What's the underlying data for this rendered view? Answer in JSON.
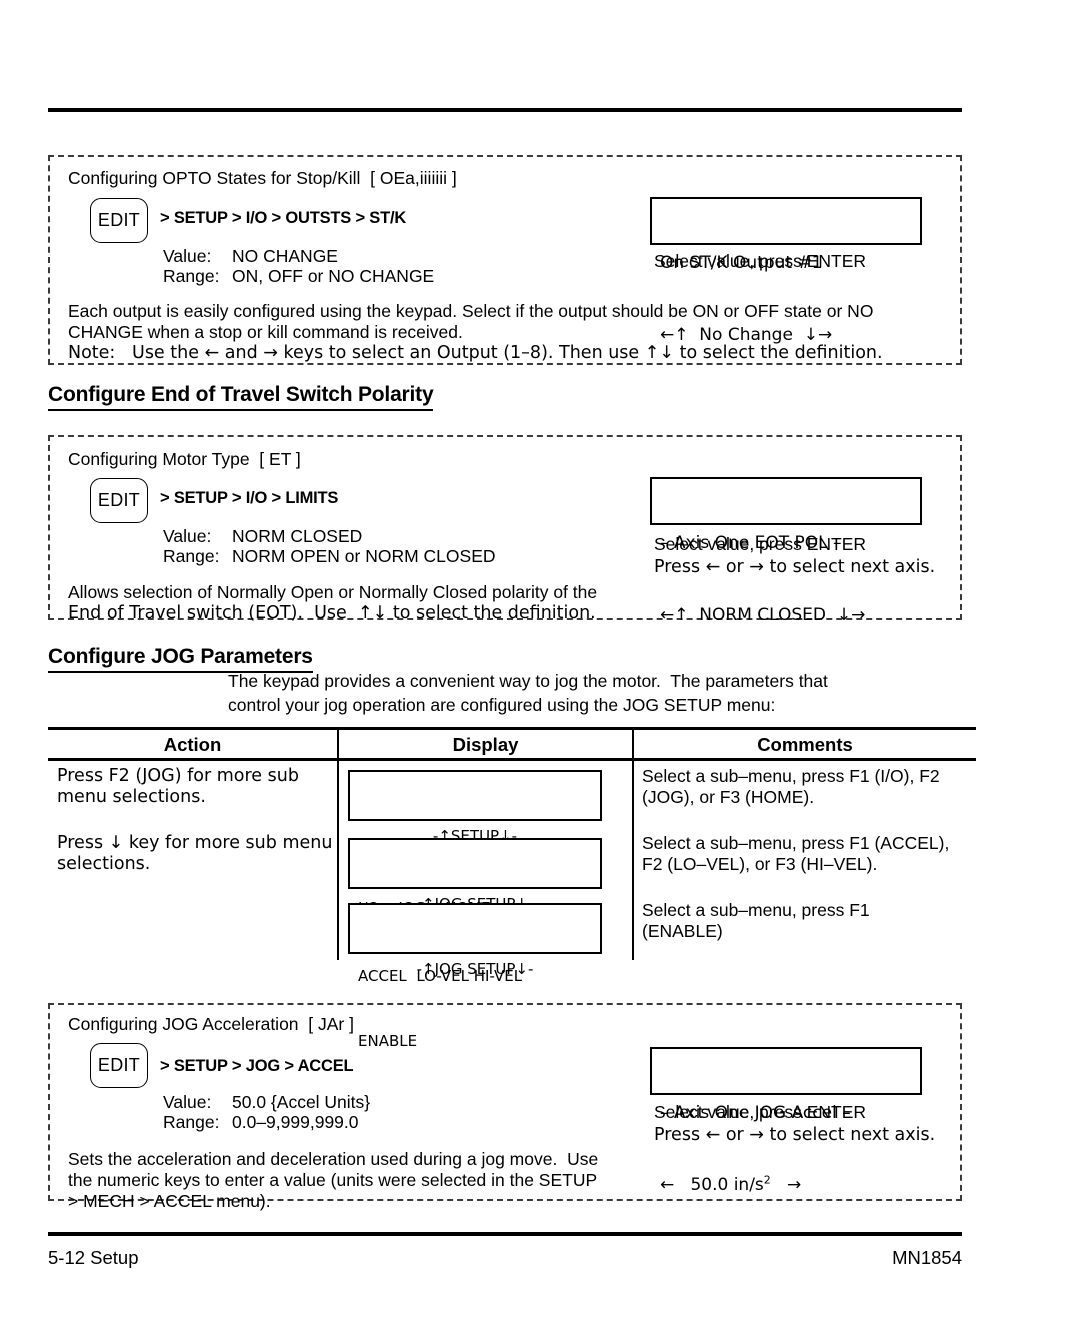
{
  "page": {
    "footer_left": "5-12 Setup",
    "footer_right": "MN1854"
  },
  "sections": [
    {
      "id": "opto-states",
      "param_title": "Configuring OPTO States for Stop/Kill  [ OEa,iiiiiii ]",
      "edit_label": "EDIT",
      "menu_path": "> SETUP > I/O > OUTSTS > ST/K",
      "value_label": "Value:",
      "value": "NO CHANGE",
      "range_label": "Range:",
      "range": "ON, OFF or NO CHANGE",
      "lcd_line1": "On ST/K Output #1",
      "lcd_line2": "←↑  No Change  ↓→",
      "lcd_caption1": "Select value, press ENTER",
      "body": "Each output is easily configured using the keypad. Select if the output should be ON or OFF state or NO CHANGE when a stop or kill command is received.",
      "note": "Note:   Use the ← and → keys to select an Output (1–8). Then use ↑↓ to select the definition."
    },
    {
      "id": "eot-polarity",
      "heading": "Configure End of Travel Switch Polarity",
      "param_title": "Configuring Motor Type  [ ET ]",
      "edit_label": "EDIT",
      "menu_path": "> SETUP > I/O > LIMITS",
      "value_label": "Value:",
      "value": "NORM CLOSED",
      "range_label": "Range:",
      "range": "NORM OPEN or NORM CLOSED",
      "lcd_line1": "– Axis One EOT POL –",
      "lcd_line2": "←↑  NORM CLOSED  ↓→",
      "lcd_caption1": "Select value, press ENTER",
      "lcd_caption2": "Press ← or → to select next axis.",
      "body_line1": "Allows selection of Normally Open or Normally Closed polarity of the",
      "body_line2": "End of Travel switch (EOT).  Use  ↑↓ to select the definition."
    },
    {
      "id": "jog-parameters",
      "heading": "Configure JOG Parameters",
      "intro_line1": "The keypad provides a convenient way to jog the motor.  The parameters that",
      "intro_line2": "control your jog operation are configured using the JOG SETUP menu:"
    },
    {
      "id": "jog-accel",
      "param_title": "Configuring JOG Acceleration  [ JAr ]",
      "edit_label": "EDIT",
      "menu_path": "> SETUP > JOG > ACCEL",
      "value_label": "Value:",
      "value": "50.0 {Accel Units}",
      "range_label": "Range:",
      "range": "0.0–9,999,999.0",
      "lcd_line1": "– Axis One JOG Accel –",
      "lcd_line2_pre": "←   50.0 in/s",
      "lcd_line2_sup": "2",
      "lcd_line2_post": "   →",
      "lcd_caption1": "Select value, press ENTER",
      "lcd_caption2": "Press ← or → to select next axis.",
      "body_line1": "Sets the acceleration and deceleration used during a jog move.  Use",
      "body_line2": "the numeric keys to enter a value (units were selected in the SETUP",
      "body_line3": "> MECH > ACCEL menu)."
    }
  ],
  "table": {
    "headers": [
      "Action",
      "Display",
      "Comments"
    ],
    "rows": [
      {
        "action_line1": "Press F2 (JOG) for more sub",
        "action_line2": "menu selections.",
        "display_line1": "-↑SETUP↓-",
        "display_line2": "I/O    JOG    HOME",
        "comment_line1": "Select a sub–menu, press F1 (I/O), F2",
        "comment_line2": "(JOG), or F3 (HOME)."
      },
      {
        "action_line1": "Press ↓ key for more sub menu",
        "action_line2": "selections.",
        "display_line1": "-↑JOG SETUP↓-",
        "display_line2": "ACCEL  LO-VEL HI-VEL",
        "comment_line1": "Select a sub–menu, press F1 (ACCEL),",
        "comment_line2": "F2 (LO–VEL), or F3 (HI–VEL)."
      },
      {
        "action_line1": "",
        "action_line2": "",
        "display_line1": "-↑JOG SETUP↓-",
        "display_line2": "ENABLE",
        "comment_line1": "Select a sub–menu, press F1",
        "comment_line2": "(ENABLE)"
      }
    ]
  }
}
